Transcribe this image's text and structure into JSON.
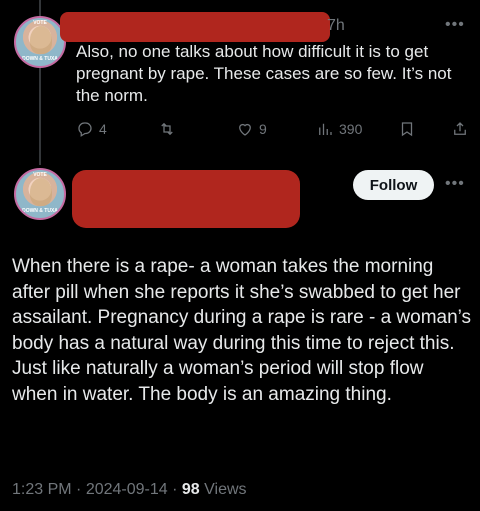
{
  "reply": {
    "time": "7h",
    "more": "•••",
    "text": "Also, no one talks about how difficult it is to get pregnant by rape. These cases are so few. It’s not the norm.",
    "counts": {
      "replies": "4",
      "likes": "9",
      "views": "390"
    },
    "avatar": {
      "ring_top": "VOTE",
      "ring_bottom": "DOWN & TUXA"
    }
  },
  "post": {
    "follow_label": "Follow",
    "more": "•••",
    "avatar": {
      "ring_top": "VOTE",
      "ring_bottom": "DOWN & TUXA"
    },
    "text": "When there is a rape- a woman takes the morning after pill when she reports it she’s swabbed to get her assailant.  Pregnancy during a rape is rare - a woman’s body has a natural way during this time to reject this. Just like naturally a woman’s period will stop flow when in water. The body is an amazing thing.",
    "time": "1:23 PM",
    "date": "2024-09-14",
    "separator": "·",
    "views_count": "98",
    "views_label": "Views"
  },
  "colors": {
    "accent_redaction": "#b0261e",
    "muted": "#71767b",
    "text": "#e7e9ea"
  }
}
